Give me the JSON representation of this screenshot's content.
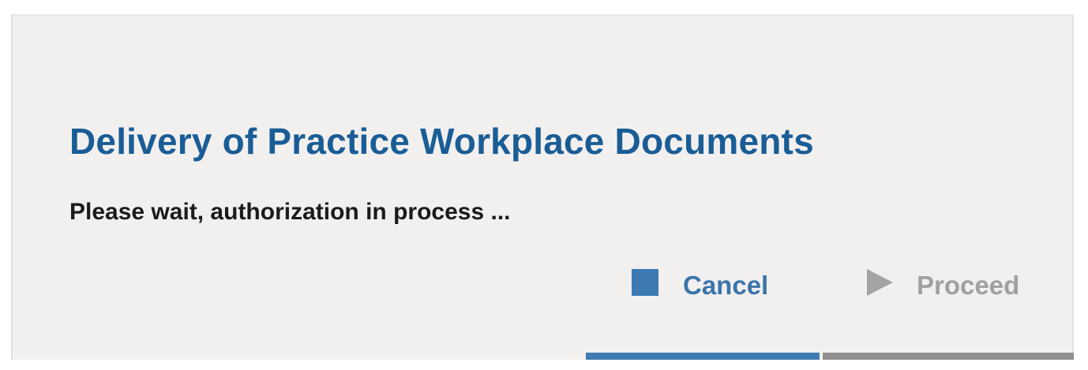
{
  "dialog": {
    "title": "Delivery of Practice Workplace Documents",
    "status": "Please wait, authorization in process ..."
  },
  "actions": {
    "cancel": {
      "label": "Cancel",
      "icon": "stop-icon",
      "accent_color": "#3D7AB3"
    },
    "proceed": {
      "label": "Proceed",
      "icon": "play-icon",
      "accent_color": "#A3A3A3"
    }
  },
  "colors": {
    "title": "#1A5D96",
    "panel_background": "#F2F0EF",
    "cancel_bar": "#3F7AB2",
    "proceed_bar": "#8F8F8F"
  }
}
